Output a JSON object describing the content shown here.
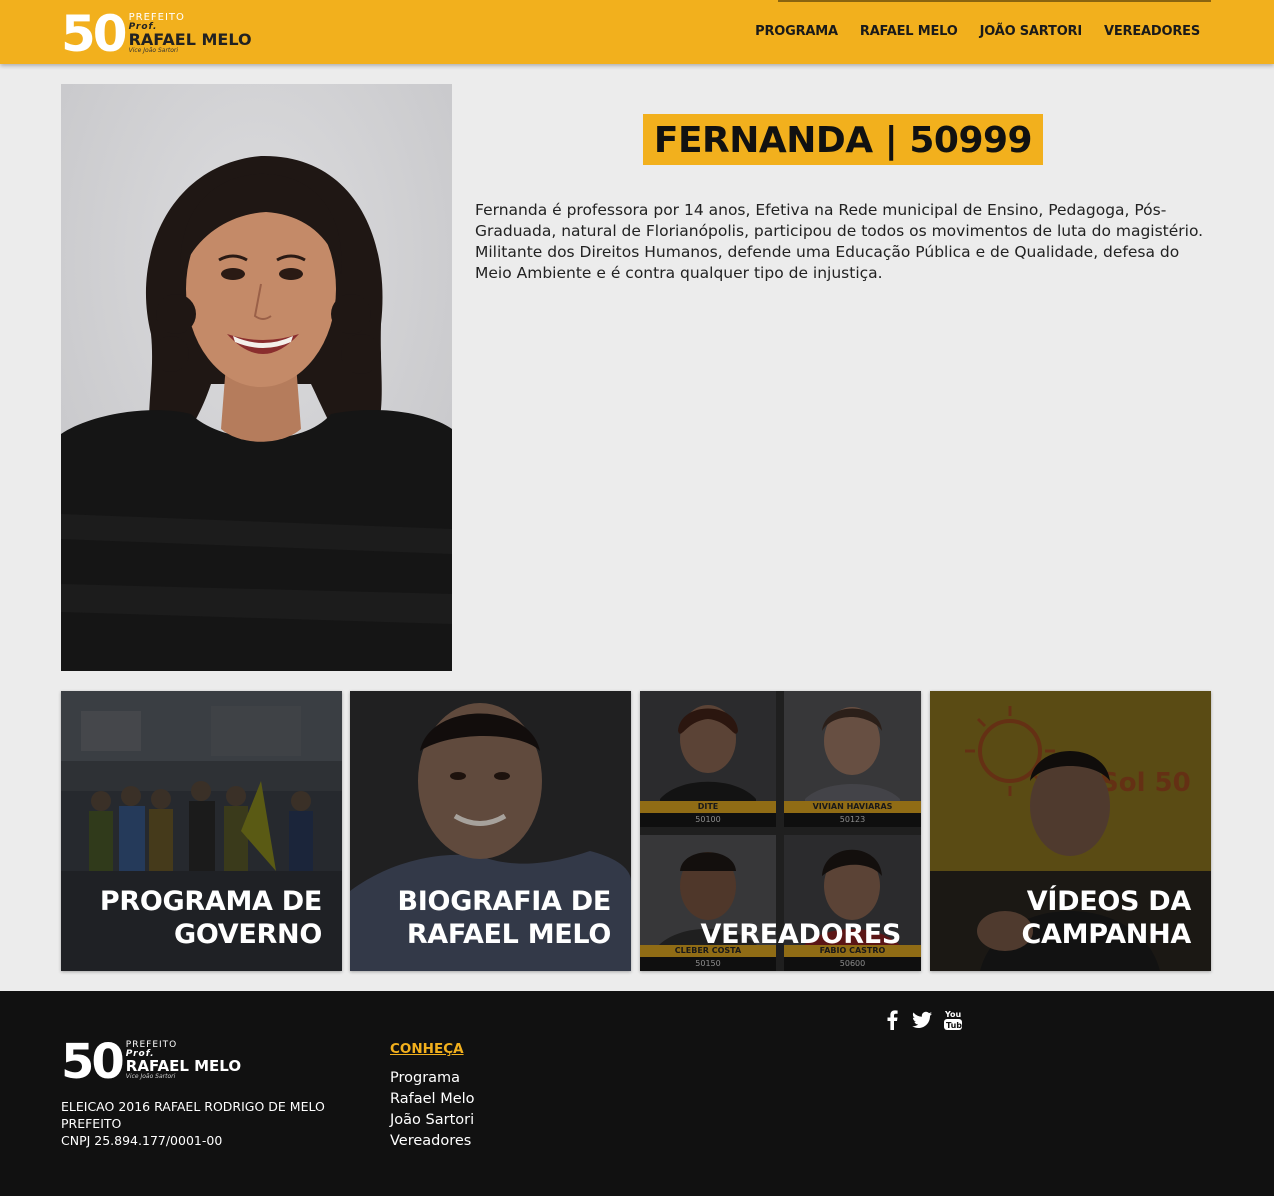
{
  "brand": {
    "number": "50",
    "prefeito": "PREFEITO",
    "prof": "Prof.",
    "name": "RAFAEL MELO",
    "vice": "Vice João Sartori"
  },
  "nav": {
    "items": [
      {
        "label": "PROGRAMA"
      },
      {
        "label": "RAFAEL MELO"
      },
      {
        "label": "JOÃO SARTORI"
      },
      {
        "label": "VEREADORES"
      }
    ]
  },
  "profile": {
    "title": "FERNANDA | 50999",
    "bio": "Fernanda é professora por 14 anos, Efetiva na Rede municipal de Ensino, Pedagoga, Pós-Graduada, natural de Florianópolis, participou de todos os movimentos de luta do magistério. Militante dos Direitos Humanos, defende uma Educação Pública e de Qualidade, defesa do Meio Ambiente e é contra qualquer tipo de injustiça."
  },
  "cards": [
    {
      "line1": "PROGRAMA DE",
      "line2": "GOVERNO"
    },
    {
      "line1": "BIOGRAFIA DE",
      "line2": "RAFAEL MELO"
    },
    {
      "line1": "",
      "line2": "VEREADORES",
      "thumbs": [
        {
          "name": "DITE",
          "number": "50100"
        },
        {
          "name": "VIVIAN HAVIARAS",
          "number": "50123"
        },
        {
          "name": "CLEBER COSTA",
          "number": "50150"
        },
        {
          "name": "FABIO CASTRO",
          "number": "50600"
        }
      ]
    },
    {
      "line1": "VÍDEOS DA",
      "line2": "CAMPANHA"
    }
  ],
  "footer": {
    "legal_line1": "ELEICAO 2016 RAFAEL RODRIGO DE MELO",
    "legal_line2": "PREFEITO",
    "legal_line3": "CNPJ 25.894.177/0001-00",
    "conheca_title": "CONHEÇA",
    "links": [
      {
        "label": "Programa"
      },
      {
        "label": "Rafael Melo"
      },
      {
        "label": "João Sartori"
      },
      {
        "label": "Vereadores"
      }
    ],
    "social_icons": [
      "facebook-icon",
      "twitter-icon",
      "youtube-icon"
    ]
  },
  "colors": {
    "accent": "#f2b01d",
    "footer_bg": "#111111",
    "page_bg": "#ececec"
  }
}
